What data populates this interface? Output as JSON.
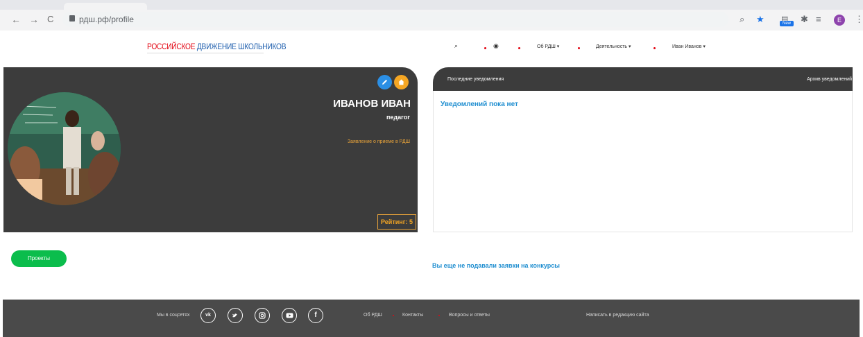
{
  "browser": {
    "url": "рдш.рф/profile",
    "back_glyph": "←",
    "forward_glyph": "→",
    "reload_glyph": "C",
    "profile_initial": "E",
    "ext_badge": "New",
    "icons": [
      "zoom-icon",
      "star-icon",
      "extension-icon",
      "puzzle-icon",
      "reading-list-icon",
      "menu-icon"
    ]
  },
  "site": {
    "logo_part1": "РОССИЙСКОЕ",
    "logo_part2": "ДВИЖЕНИЕ ШКОЛЬНИКОВ",
    "nav": {
      "about": "Об РДШ ▾",
      "activity": "Деятельность ▾",
      "user": "Иван Иванов ▾"
    }
  },
  "profile": {
    "name": "ИВАНОВ ИВАН",
    "role": "педагог",
    "application_link": "Заявление о приеме в РДШ",
    "rating": "Рейтинг: 5"
  },
  "notifications": {
    "title": "Последние уведомления",
    "archive": "Архив уведомлений",
    "empty": "Уведомлений пока нет"
  },
  "projects": {
    "button": "Проекты",
    "message": "Вы еще не подавали заявки на конкурсы"
  },
  "footer": {
    "social_label": "Мы в соцсетях",
    "social": [
      "vk",
      "twitter",
      "instagram",
      "youtube",
      "facebook"
    ],
    "links": [
      "Об РДШ",
      "Контакты",
      "Вопросы и ответы"
    ],
    "write": "Написать в редакцию сайта"
  },
  "colors": {
    "dark": "#3c3c3c",
    "accent_orange": "#f5a623",
    "accent_blue": "#1f8ed0",
    "green": "#0bbd4c",
    "red": "#e30613"
  }
}
